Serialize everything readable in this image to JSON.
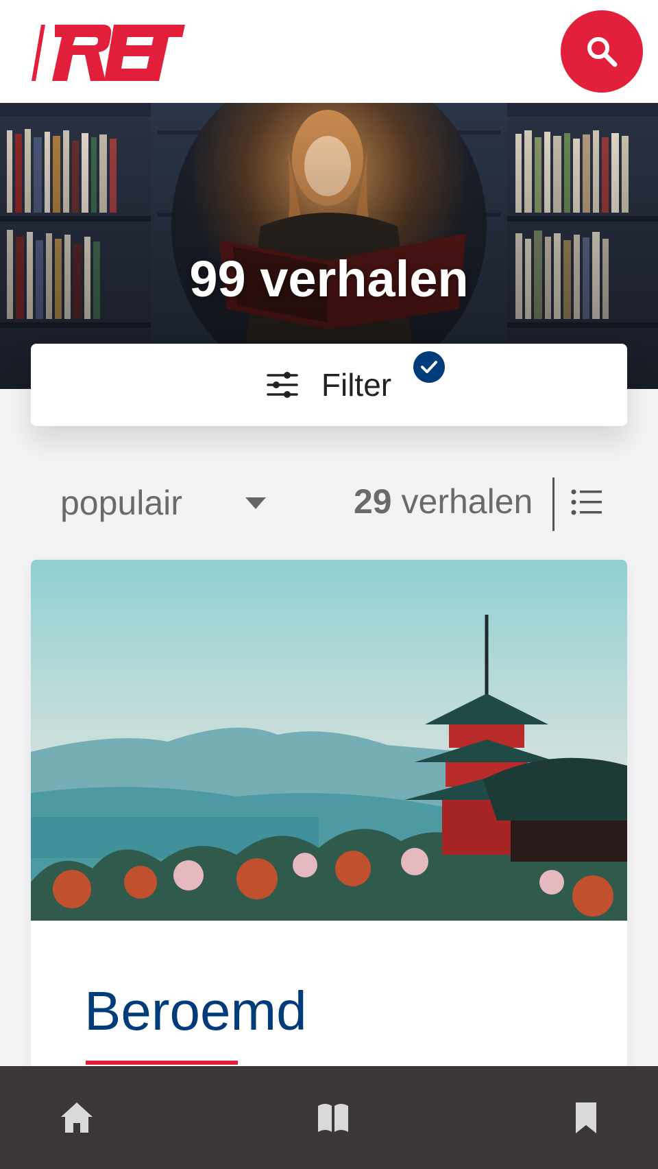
{
  "brand": {
    "logo_text": "RET",
    "accent": "#e3203b",
    "primary": "#003b7a"
  },
  "header": {
    "search_icon": "search-icon"
  },
  "hero": {
    "title": "99 verhalen"
  },
  "filter": {
    "label": "Filter",
    "icon": "sliders-icon",
    "active_icon": "check-circle-icon"
  },
  "sort": {
    "selected": "populair",
    "count_number": "29",
    "count_suffix": " verhalen",
    "list_icon": "list-view-icon"
  },
  "story": {
    "title": "Beroemd"
  },
  "nav": {
    "items": [
      "home-icon",
      "book-icon",
      "bookmark-icon"
    ]
  }
}
